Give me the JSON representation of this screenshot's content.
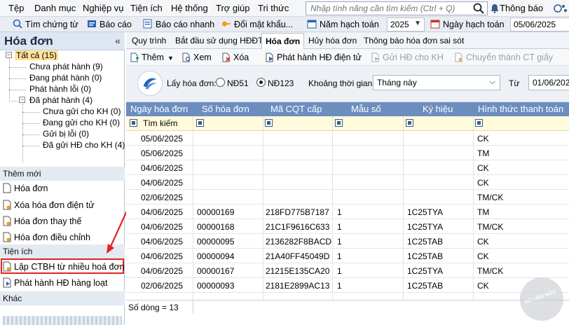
{
  "menu": [
    "Tệp",
    "Danh mục",
    "Nghiệp vụ",
    "Tiện ích",
    "Hệ thống",
    "Trợ giúp",
    "Tri thức"
  ],
  "search": {
    "placeholder": "Nhập tính năng cần tìm kiếm (Ctrl + Q)"
  },
  "notifications_label": "Thông báo",
  "toolbar": {
    "find_voucher": "Tìm chứng từ",
    "report": "Báo cáo",
    "quick_report": "Báo cáo nhanh",
    "change_password": "Đổi mật khẩu...",
    "fiscal_year_label": "Năm hạch toán",
    "fiscal_year_value": "2025",
    "posting_date_label": "Ngày hạch toán",
    "posting_date_value": "05/06/2025"
  },
  "sidebar": {
    "title": "Hóa đơn",
    "collapse": "«",
    "tree": {
      "all": "Tất cả (15)",
      "not_issued": "Chưa phát hành (9)",
      "issuing": "Đang phát hành (0)",
      "issue_error": "Phát hành lỗi (0)",
      "issued": "Đã phát hành (4)",
      "not_sent": "Chưa gửi cho KH (0)",
      "sending": "Đang gửi cho KH (0)",
      "send_error": "Gửi bị lỗi (0)",
      "sent": "Đã gửi HĐ cho KH (4)"
    },
    "section_new": "Thêm mới",
    "new_links": [
      "Hóa đơn",
      "Xóa hóa đơn điện tử",
      "Hóa đơn thay thế",
      "Hóa đơn điều chỉnh"
    ],
    "section_utils": "Tiện ích",
    "util_links": [
      "Lập CTBH từ nhiều hoá đơn",
      "Phát hành HĐ hàng loạt"
    ],
    "section_other": "Khác"
  },
  "tabs": [
    "Quy trình",
    "Bắt đầu sử dụng HĐĐT",
    "Hóa đơn",
    "Hủy hóa đơn",
    "Thông báo hóa đơn sai sót"
  ],
  "active_tab": "Hóa đơn",
  "actions": {
    "add": "Thêm",
    "view": "Xem",
    "delete": "Xóa",
    "issue": "Phát hành HĐ điện tử",
    "send": "Gửi HĐ cho KH",
    "convert": "Chuyển thành CT giấy"
  },
  "filter": {
    "get_invoice_label": "Lấy hóa đơn:",
    "option_nd51": "NĐ51",
    "option_nd123": "NĐ123",
    "selected_option": "NĐ123",
    "period_label": "Khoảng thời gian",
    "period_value": "Tháng này",
    "from_label": "Từ",
    "from_value": "01/06/2025"
  },
  "grid": {
    "columns": [
      "Ngày hóa đơn",
      "Số hóa đơn",
      "Mã CQT cấp",
      "Mẫu số",
      "Ký hiệu",
      "Hình thức thanh toán"
    ],
    "filter_placeholder": "Tìm kiếm",
    "rows": [
      [
        "05/06/2025",
        "",
        "",
        "",
        "",
        "CK"
      ],
      [
        "05/06/2025",
        "",
        "",
        "",
        "",
        "TM"
      ],
      [
        "04/06/2025",
        "",
        "",
        "",
        "",
        "CK"
      ],
      [
        "04/06/2025",
        "",
        "",
        "",
        "",
        "CK"
      ],
      [
        "02/06/2025",
        "",
        "",
        "",
        "",
        "TM/CK"
      ],
      [
        "04/06/2025",
        "00000169",
        "218FD775B7187",
        "1",
        "1C25TYA",
        "TM"
      ],
      [
        "04/06/2025",
        "00000168",
        "21C1F9616C633",
        "1",
        "1C25TYA",
        "TM/CK"
      ],
      [
        "04/06/2025",
        "00000095",
        "2136282F8BACD",
        "1",
        "1C25TAB",
        "CK"
      ],
      [
        "04/06/2025",
        "00000094",
        "21A40FF45049D",
        "1",
        "1C25TAB",
        "CK"
      ],
      [
        "04/06/2025",
        "00000167",
        "21215E135CA20",
        "1",
        "1C25TYA",
        "TM/CK"
      ],
      [
        "02/06/2025",
        "00000093",
        "2181E2899AC13",
        "1",
        "1C25TAB",
        "CK"
      ]
    ],
    "row_count": "Số dòng = 13"
  },
  "watermark": "DỮ LIỆU MẪU",
  "colors": {
    "grid_header": "#6c8ebf",
    "filter_row": "#fffbdc",
    "highlight": "#e02424",
    "tree_selected": "#ffe49a"
  }
}
